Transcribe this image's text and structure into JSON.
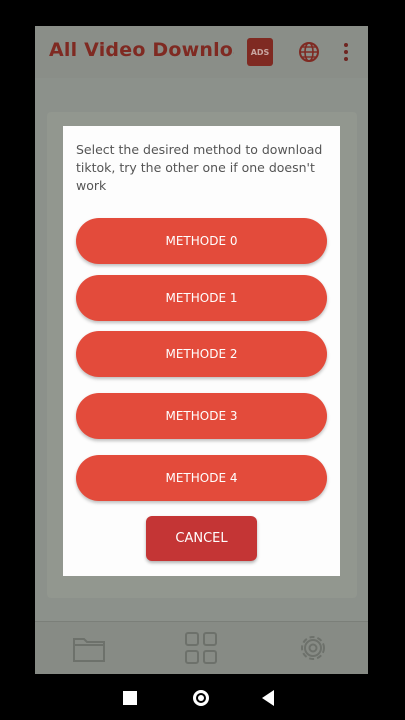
{
  "app": {
    "title": "All Video Downloa...",
    "ads_badge": "ADS"
  },
  "icons": {
    "globe": "globe-icon",
    "more": "more-vert-icon",
    "folder": "folder-icon",
    "grid": "grid-icon",
    "settings": "gear-icon"
  },
  "dialog": {
    "message": "Select the desired method to download tiktok, try the other one if one doesn't work",
    "methods": [
      "METHODE 0",
      "METHODE 1",
      "METHODE 2",
      "METHODE 3",
      "METHODE 4"
    ],
    "cancel_label": "CANCEL"
  },
  "colors": {
    "accent": "#e34b3b",
    "cancel": "#c43535",
    "dim_overlay": "#8c918b"
  }
}
